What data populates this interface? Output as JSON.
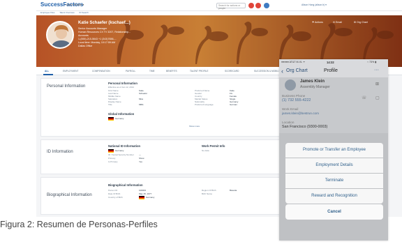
{
  "desktop": {
    "logo": "SuccessFactors",
    "home_dropdown": "Home Profile ▾",
    "subnav": [
      "Employee Files",
      "Talent Overview",
      "ID Search"
    ],
    "search_placeholder": "Search for actions or people",
    "user_link": "Alison Hong (alison.h) ▾",
    "badge_colors": [
      "#e0453a",
      "#e0453a",
      "#3e7bc2"
    ],
    "profile": {
      "name": "Katie Schaefer (kschaef...)",
      "lines": [
        "Senior Accounts Manager",
        "Human Resources CX TV 3207, Relationship...",
        "Accounts",
        "1-(555)-215-5643 +1 (343)7656-...",
        "Local time: Monday, 10:17:59 AM",
        "Dallas Office"
      ],
      "buttons": [
        "⚑ Actions",
        "✉ Email",
        "⊞ Org Chart"
      ]
    },
    "tabs": [
      "ALL",
      "EMPLOYMENT",
      "COMPENSATION",
      "PAYROLL",
      "TIME",
      "BENEFITS",
      "TALENT PROFILE",
      "SCORECARD",
      "SUCCESSION & MOBILITY",
      "MORE"
    ],
    "sections": [
      {
        "title": "Personal Information",
        "sub": "Personal Information",
        "note": "Effective as of Jan 12, 2014",
        "left_labels": [
          "First Name",
          "Last Name",
          "Middle Name",
          "Salutation",
          "Display Name",
          "Title"
        ],
        "left_values": [
          "Katie",
          "Schaefer",
          "",
          "Miss",
          "",
          "MBA"
        ],
        "right_labels": [
          "Preferred Name",
          "Gender",
          "Country",
          "Marital Status",
          "Nationality",
          "Preferred Language"
        ],
        "right_values": [
          "Katie",
          "F/L",
          "Female",
          "Single",
          "Germany",
          "German"
        ],
        "global": "Global Information",
        "global_value": "Germany",
        "show_more": "Show more"
      },
      {
        "title": "ID Information",
        "sub": "National ID Information",
        "labels": [
          "Country",
          "ID / Social Security Number",
          "Primary",
          "Is Primary"
        ],
        "values": [
          "Germany",
          "—",
          "Show",
          "Yes"
        ],
        "right_title": "Work Permit Info",
        "right_note": "No data"
      },
      {
        "title": "Biographical Information",
        "sub": "Biographical Information",
        "labels": [
          "Person ID",
          "Date Of Birth",
          "Country of Birth"
        ],
        "values": [
          "100033",
          "May 15, 1977",
          "Germany"
        ],
        "right_labels": [
          "Region Of Birth",
          "Birth Name"
        ],
        "right_values": [
          "Bavaria",
          ""
        ]
      }
    ]
  },
  "phone": {
    "status_left": "●●●●● AT&T M-VL ᯤ",
    "status_center": "14:32",
    "status_right": "⌁ 73% ▮",
    "back_label": "Org Chart",
    "title": "Profile",
    "more": "···",
    "employee_name": "James Klein",
    "employee_title": "Assembly Manager",
    "business_phone_label": "Business Phone",
    "business_phone": "(1) 732 555-4222",
    "work_email_label": "Work Email",
    "work_email": "james.klein@bestrun.com",
    "location_label": "Location",
    "location": "San Francisco (9300-0003)",
    "actions": [
      "Promote or Transfer an Employee",
      "Employment Details",
      "Terminate",
      "Reward and Recognition"
    ],
    "cancel": "Cancel"
  },
  "caption": "Figura 2: Resumen de Personas-Perfiles"
}
